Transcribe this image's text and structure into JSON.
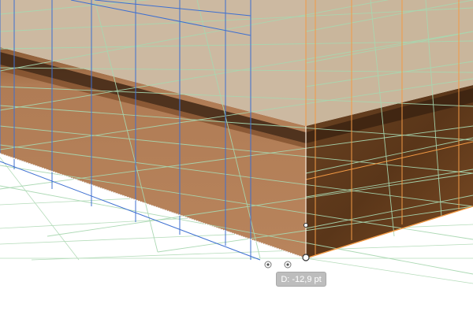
{
  "canvas": {
    "background": "#ffffff"
  },
  "colors": {
    "left_face_top": "#b07c55",
    "left_face_bottom": "#b27e56",
    "right_face_top": "#4a2c16",
    "right_face_bottom": "#7a4a24",
    "top_face": "#c9b59c",
    "recess": "#3e2614",
    "grid_green": "#a8d7b0",
    "grid_blue": "#3d6fd1",
    "grid_orange": "#f29a45",
    "anchor_stroke": "#333333"
  },
  "icons": {
    "perspective_widget": "double-circle-icon",
    "anchor_point": "anchor-point-icon"
  },
  "tooltip": {
    "text": "D: -12,9 pt"
  }
}
